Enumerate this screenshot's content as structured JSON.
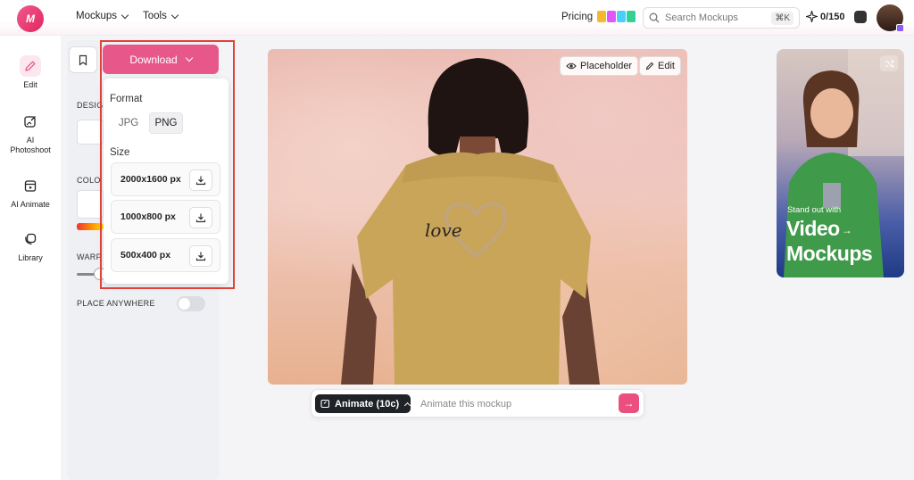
{
  "header": {
    "logo_text": "M",
    "nav": [
      {
        "label": "Mockups"
      },
      {
        "label": "Tools"
      }
    ],
    "pricing_label": "Pricing",
    "search": {
      "placeholder": "Search Mockups",
      "shortcut": "⌘K"
    },
    "credits": "0/150"
  },
  "rail": [
    {
      "label": "Edit",
      "icon": "pencil-icon",
      "active": true
    },
    {
      "label": "AI Photoshoot",
      "icon": "photo-edit-icon"
    },
    {
      "label": "AI Animate",
      "icon": "clapper-icon"
    },
    {
      "label": "Library",
      "icon": "layers-icon"
    }
  ],
  "panel": {
    "design_label": "DESIG",
    "color_label": "COLO",
    "warp_label": "WARP",
    "place_anywhere_label": "PLACE ANYWHERE"
  },
  "download": {
    "button_label": "Download",
    "format_label": "Format",
    "formats": [
      "JPG",
      "PNG"
    ],
    "selected_format": "PNG",
    "size_label": "Size",
    "sizes": [
      "2000x1600 px",
      "1000x800 px",
      "500x400 px"
    ]
  },
  "canvas": {
    "placeholder_label": "Placeholder",
    "edit_label": "Edit",
    "shirt_text": "love"
  },
  "animate": {
    "button_label": "Animate (10c)",
    "input_placeholder": "Animate this mockup"
  },
  "promo": {
    "subtitle": "Stand out with",
    "title_line1": "Video",
    "title_line2": "Mockups"
  },
  "colors": {
    "brand_pink": "#e8578a",
    "highlight_red": "#e0413b"
  }
}
